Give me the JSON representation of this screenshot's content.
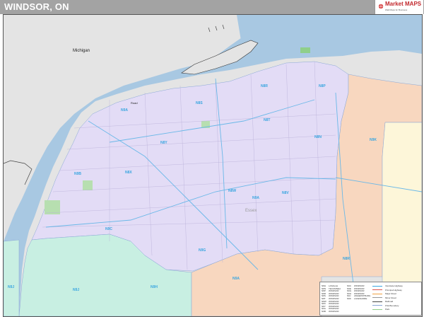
{
  "header": {
    "title": "WINDSOR, ON",
    "logo_text": "Market MAPS",
    "logo_tagline": "Wall Maps for Business"
  },
  "map": {
    "region_label": "Michigan",
    "place_labels": {
      "river_label": "Essex",
      "point_label": "Road"
    },
    "fsa_labels": [
      "N9A",
      "N9B",
      "N9C",
      "N9E",
      "N9G",
      "N9H",
      "N9J",
      "N8H",
      "N8N",
      "N8P",
      "N8R",
      "N8S",
      "N8T",
      "N8W",
      "N8X",
      "N8Y",
      "N9K",
      "N9V",
      "N8V",
      "N9Y"
    ],
    "colors": {
      "water": "#a8c8e2",
      "land_outside": "#e4e4e4",
      "zone_lavender": "#e3dcf6",
      "zone_green": "#c8efe2",
      "zone_peach": "#f8d7bf",
      "zone_yellow": "#fdf6d9",
      "label_blue": "#3aa6e0"
    }
  },
  "legend": {
    "table_rows": [
      [
        "N8H",
        "LASALLE",
        "N9C",
        "WINDSOR"
      ],
      [
        "N8N",
        "TECUMSEH",
        "N9E",
        "WINDSOR"
      ],
      [
        "N8P",
        "WINDSOR",
        "N9G",
        "WINDSOR"
      ],
      [
        "N8R",
        "WINDSOR",
        "N9H",
        "WINDSOR"
      ],
      [
        "N8S",
        "WINDSOR",
        "N9J",
        "AMHERSTBURG"
      ],
      [
        "N8T",
        "WINDSOR",
        "N9K",
        "LAKESHORE"
      ],
      [
        "N8W",
        "WINDSOR",
        "",
        ""
      ],
      [
        "N8X",
        "WINDSOR",
        "",
        ""
      ],
      [
        "N8Y",
        "WINDSOR",
        "",
        ""
      ],
      [
        "N9A",
        "WINDSOR",
        "",
        ""
      ],
      [
        "N9B",
        "WINDSOR",
        "",
        ""
      ]
    ],
    "key_items": [
      "Interstate Highway",
      "Principal Highway",
      "Major Road",
      "Minor Road",
      "Railroad",
      "FSA Boundary",
      "Park"
    ]
  }
}
